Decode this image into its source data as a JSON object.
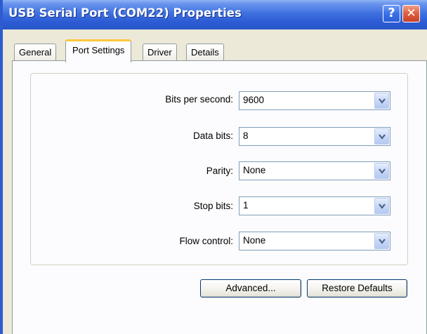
{
  "window": {
    "title": "USB Serial Port (COM22) Properties",
    "help_glyph": "?",
    "close_glyph": "✕"
  },
  "tabs": [
    {
      "label": "General",
      "active": false
    },
    {
      "label": "Port Settings",
      "active": true
    },
    {
      "label": "Driver",
      "active": false
    },
    {
      "label": "Details",
      "active": false
    }
  ],
  "settings": {
    "bits_per_second": {
      "label": "Bits per second:",
      "value": "9600"
    },
    "data_bits": {
      "label": "Data bits:",
      "value": "8"
    },
    "parity": {
      "label": "Parity:",
      "value": "None"
    },
    "stop_bits": {
      "label": "Stop bits:",
      "value": "1"
    },
    "flow_control": {
      "label": "Flow control:",
      "value": "None"
    }
  },
  "buttons": {
    "advanced": "Advanced...",
    "restore_defaults": "Restore Defaults"
  },
  "colors": {
    "titlebar": "#2c5bd4",
    "active_tab_accent": "#ffc73c",
    "dialog_face": "#ece9d8",
    "close_button": "#e0623f"
  },
  "icons": {
    "help": "help-icon",
    "close": "close-icon",
    "dropdown": "chevron-down-icon"
  }
}
